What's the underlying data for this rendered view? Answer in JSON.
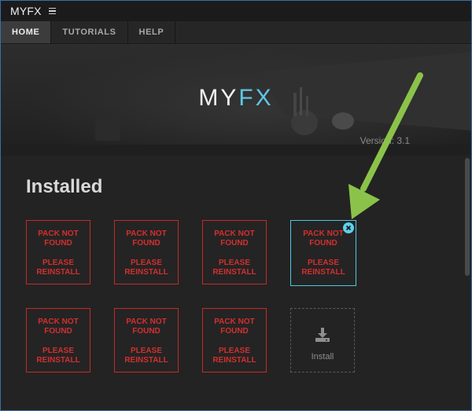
{
  "app": {
    "title": "MYFX",
    "menu_icon": "hamburger-menu-icon"
  },
  "tabs": [
    {
      "label": "HOME",
      "active": true
    },
    {
      "label": "TUTORIALS",
      "active": false
    },
    {
      "label": "HELP",
      "active": false
    }
  ],
  "hero": {
    "logo_my": "MY",
    "logo_fx": "FX",
    "version": "Version: 3.1"
  },
  "installed": {
    "title": "Installed",
    "packs": [
      {
        "line1": "PACK NOT FOUND",
        "line2": "PLEASE REINSTALL"
      },
      {
        "line1": "PACK NOT FOUND",
        "line2": "PLEASE REINSTALL"
      },
      {
        "line1": "PACK NOT FOUND",
        "line2": "PLEASE REINSTALL"
      },
      {
        "line1": "PACK NOT FOUND",
        "line2": "PLEASE REINSTALL",
        "selected": true
      },
      {
        "line1": "PACK NOT FOUND",
        "line2": "PLEASE REINSTALL"
      },
      {
        "line1": "PACK NOT FOUND",
        "line2": "PLEASE REINSTALL"
      },
      {
        "line1": "PACK NOT FOUND",
        "line2": "PLEASE REINSTALL"
      }
    ],
    "install_label": "Install"
  },
  "colors": {
    "accent": "#5fc7e6",
    "error": "#d32f2f",
    "annotation_arrow": "#8bc34a",
    "window_border": "#3a6ea8"
  }
}
